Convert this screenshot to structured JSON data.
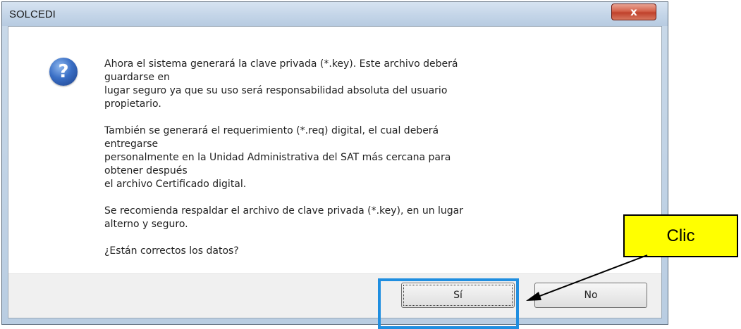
{
  "window": {
    "title": "SOLCEDI",
    "close_glyph": "x"
  },
  "icon": {
    "name": "question-icon",
    "glyph": "?"
  },
  "message": {
    "paragraphs": [
      [
        "Ahora el sistema generará la clave privada (*.key). Este archivo deberá",
        "guardarse en",
        "lugar seguro ya que su uso será responsabilidad absoluta del usuario",
        "propietario."
      ],
      [
        "También se generará el requerimiento (*.req) digital, el cual deberá",
        "entregarse",
        "personalmente en la Unidad Administrativa del SAT más cercana para",
        "obtener después",
        "el archivo Certificado digital."
      ],
      [
        "Se recomienda respaldar el archivo de clave privada (*.key), en un lugar",
        "alterno y seguro."
      ],
      [
        "¿Están correctos los datos?"
      ]
    ]
  },
  "buttons": {
    "yes_label": "Sí",
    "no_label": "No"
  },
  "annotation": {
    "label": "Clic",
    "label_color": "#ffff00",
    "highlight_color": "#1f8ee0"
  }
}
